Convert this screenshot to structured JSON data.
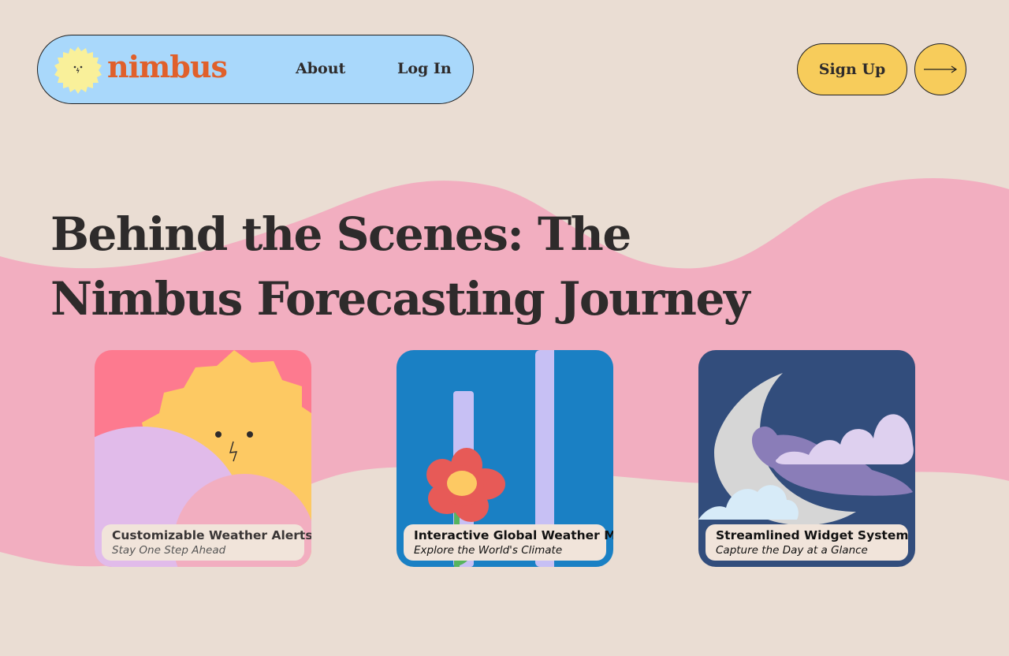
{
  "brand": {
    "name": "nimbus"
  },
  "nav": {
    "about": "About",
    "login": "Log In"
  },
  "cta": {
    "signup": "Sign Up",
    "arrow_icon": "arrow-right-icon"
  },
  "hero": {
    "title": "Behind the Scenes: The Nimbus Forecasting Journey"
  },
  "cards": [
    {
      "title": "Customizable Weather Alerts",
      "subtitle": "Stay One Step Ahead",
      "illustration": "sun-behind-clouds"
    },
    {
      "title": "Interactive Global Weather Map",
      "subtitle": "Explore the World's Climate",
      "illustration": "flower-on-blue"
    },
    {
      "title": "Streamlined Widget System",
      "subtitle": "Capture the Day at a Glance",
      "illustration": "moon-and-clouds"
    }
  ],
  "colors": {
    "background": "#eaddd3",
    "wave": "#f2aec0",
    "nav_pill": "#a9d8fb",
    "brand": "#e0602b",
    "cta": "#f7cc5b",
    "text": "#2e2b2b"
  }
}
